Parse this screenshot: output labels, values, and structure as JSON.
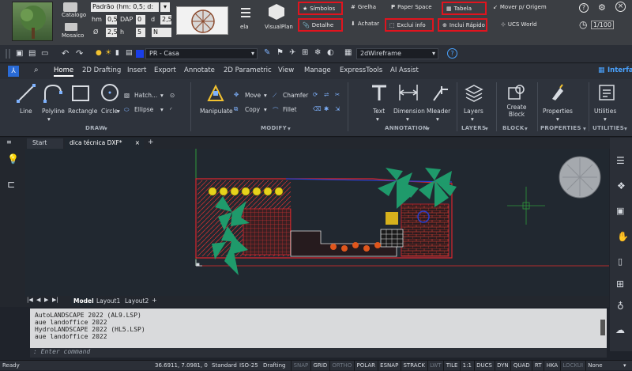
{
  "plugin_bar": {
    "catalogo": "Catalogo",
    "mosaico": "Mosaico",
    "style_value": "Padrão (hm: 0,5; d:",
    "hm_label": "hm",
    "hm_value": "0,5",
    "dap_label": "DAP",
    "dap_value": "0",
    "d_label": "d",
    "d_value": "2,5",
    "diam_label": "Ø",
    "diam_value": "2,5",
    "h_label": "h",
    "h_value": "5",
    "dir_value": "N",
    "ela_label": "ela",
    "visualplan": "VisualPlan",
    "simbolos": "Símbolos",
    "detalhe": "Detalhe",
    "grelha": "Grelha",
    "achatar": "Achatar",
    "paper_space": "Paper Space",
    "exclui_info": "Exclui info",
    "tabela": "Tabela",
    "inclui_rapido": "Inclui Rápido",
    "mover_origem": "Mover p/ Origem",
    "ucs_world": "UCS World",
    "scale": "1/100"
  },
  "qat": {
    "layer_name": "PR - Casa",
    "visual_style": "2dWireframe"
  },
  "ribbon_tabs": [
    "Home",
    "2D Drafting",
    "Insert",
    "Export",
    "Annotate",
    "2D Parametric",
    "View",
    "Manage",
    "ExpressTools",
    "AI Assist"
  ],
  "ribbon_tab_right": "Interfa",
  "ribbon": {
    "line": "Line",
    "polyline": "Polyline",
    "rectangle": "Rectangle",
    "circle": "Circle",
    "hatch": "Hatch...",
    "ellipse": "Ellipse",
    "draw": "DRAW",
    "manipulate": "Manipulate",
    "move": "Move",
    "copy": "Copy",
    "chamfer": "Chamfer",
    "fillet": "Fillet",
    "modify": "MODIFY",
    "text": "Text",
    "dimension": "Dimension",
    "mleader": "Mleader",
    "annotation": "ANNOTATION",
    "layers": "Layers",
    "layers_title": "LAYERS",
    "create_block": "Create Block",
    "block": "BLOCK",
    "properties": "Properties",
    "properties_title": "PROPERTIES",
    "utilities": "Utilities",
    "utilities_title": "UTILITIES"
  },
  "file_tabs": {
    "start": "Start",
    "active": "dica técnica DXF*",
    "plus": "+"
  },
  "layout_tabs": [
    "Model",
    "Layout1",
    "Layout2"
  ],
  "cmd_history": [
    "AutoLANDSCAPE 2022 (AL9.LSP)",
    "aue landoffice 2022",
    "HydroLANDSCAPE 2022 (HL5.LSP)",
    "aue landoffice 2022"
  ],
  "cmd_prompt": ": Enter command",
  "status": {
    "ready": "Ready",
    "coords": "36.6911, 7.0981, 0",
    "standard": "Standard",
    "iso": "ISO-25",
    "drafting": "Drafting",
    "toggles": [
      {
        "t": "SNAP",
        "on": false
      },
      {
        "t": "GRID",
        "on": true
      },
      {
        "t": "ORTHO",
        "on": false
      },
      {
        "t": "POLAR",
        "on": true
      },
      {
        "t": "ESNAP",
        "on": true
      },
      {
        "t": "STRACK",
        "on": true
      },
      {
        "t": "LWT",
        "on": false
      },
      {
        "t": "TILE",
        "on": true
      },
      {
        "t": "1:1",
        "on": true
      },
      {
        "t": "DUCS",
        "on": true
      },
      {
        "t": "DYN",
        "on": true
      },
      {
        "t": "QUAD",
        "on": true
      },
      {
        "t": "RT",
        "on": true
      },
      {
        "t": "HKA",
        "on": true
      },
      {
        "t": "LOCKUI",
        "on": false
      },
      {
        "t": "None",
        "on": true
      }
    ]
  },
  "colors": {
    "accent_red": "#e0141e",
    "palm": "#1f9a6b",
    "flower": "#e6d21c",
    "hatch": "#d23a3a"
  }
}
